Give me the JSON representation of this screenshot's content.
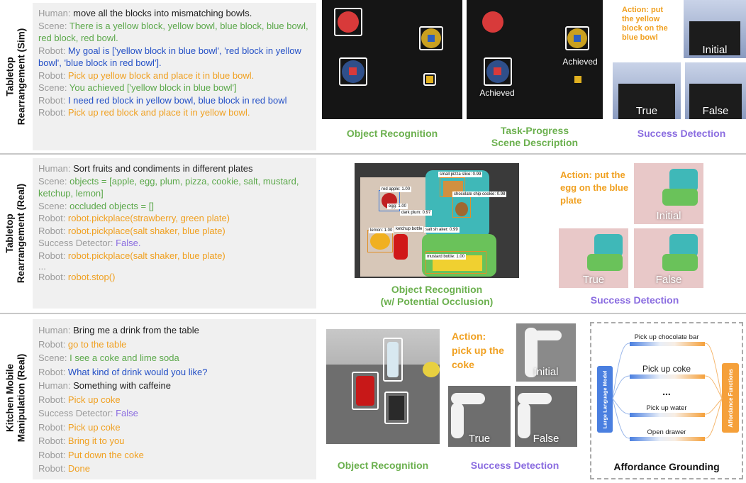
{
  "rows": [
    {
      "label": "Tabletop\nRearrangement (Sim)",
      "dialog": [
        {
          "speaker": "Human: ",
          "text": "move all the blocks into mismatching bowls.",
          "color": "human"
        },
        {
          "speaker": "Scene: ",
          "text": "There is a yellow block, yellow bowl, blue block, blue bowl, red block, red bowl.",
          "color": "scene"
        },
        {
          "speaker": "Robot: ",
          "text": "My goal is ['yellow block in blue bowl', 'red block in yellow bowl', 'blue block in red bowl'].",
          "color": "robot-blue"
        },
        {
          "speaker": "Robot: ",
          "text": "Pick up yellow block and place it in blue bowl.",
          "color": "robot-orange"
        },
        {
          "speaker": "Scene: ",
          "text": "You achieved ['yellow block in blue bowl']",
          "color": "scene"
        },
        {
          "speaker": "Robot: ",
          "text": "I need red block in yellow bowl, blue block in red bowl",
          "color": "robot-blue"
        },
        {
          "speaker": "Robot: ",
          "text": "Pick up red block and place it in yellow bowl.",
          "color": "robot-orange"
        }
      ],
      "captions": {
        "object_recognition": "Object Recognition",
        "task_progress": "Task-Progress\nScene Description",
        "success_detection": "Success Detection"
      },
      "achieved_label": "Achieved",
      "action": "Action: put the yellow block on the blue bowl",
      "initial": "Initial",
      "true": "True",
      "false": "False"
    },
    {
      "label": "Tabletop\nRearrangement (Real)",
      "dialog": [
        {
          "speaker": "Human: ",
          "text": "Sort fruits and condiments in different plates",
          "color": "human"
        },
        {
          "speaker": "Scene: ",
          "text": "objects = [apple, egg, plum, pizza, cookie, salt, mustard, ketchup, lemon]",
          "color": "scene"
        },
        {
          "speaker": "Scene: ",
          "text": "occluded objects = []",
          "color": "scene"
        },
        {
          "speaker": "Robot: ",
          "text": "robot.pickplace(strawberry, green plate)",
          "color": "robot-orange"
        },
        {
          "speaker": "Robot: ",
          "text": "robot.pickplace(salt shaker, blue plate)",
          "color": "robot-orange"
        },
        {
          "speaker": "Success Detector: ",
          "text": "False.",
          "color": "success"
        },
        {
          "speaker": "Robot: ",
          "text": "robot.pickplace(salt shaker, blue plate)",
          "color": "robot-orange"
        },
        {
          "speaker": "...",
          "text": "",
          "color": "gray"
        },
        {
          "speaker": "Robot: ",
          "text": "robot.stop()",
          "color": "robot-orange"
        }
      ],
      "detections": [
        {
          "label": "small pizza slice: 0.99"
        },
        {
          "label": "chocolate chip cookie: 0.98"
        },
        {
          "label": "red apple: 1.00"
        },
        {
          "label": "egg: 1.00"
        },
        {
          "label": "dark plum: 0.97"
        },
        {
          "label": "lemon: 1.00"
        },
        {
          "label": "ketchup bottle"
        },
        {
          "label": "salt sh aker: 0.99"
        },
        {
          "label": "mustard bottle: 1.00"
        }
      ],
      "captions": {
        "object_recognition": "Object Recognition\n(w/ Potential Occlusion)",
        "success_detection": "Success Detection"
      },
      "action": "Action: put the egg on the blue plate",
      "initial": "Initial",
      "true": "True",
      "false": "False"
    },
    {
      "label": "Kitchen Mobile\nManipulation (Real)",
      "dialog": [
        {
          "speaker": "Human: ",
          "text": "Bring me a drink from the table",
          "color": "human"
        },
        {
          "speaker": "Robot: ",
          "text": "go to the table",
          "color": "robot-orange"
        },
        {
          "speaker": "Scene: ",
          "text": "I see a coke and lime soda",
          "color": "scene"
        },
        {
          "speaker": "Robot: ",
          "text": "What kind of drink would you like?",
          "color": "robot-blue"
        },
        {
          "speaker": "Human: ",
          "text": "Something with caffeine",
          "color": "human"
        },
        {
          "speaker": "Robot: ",
          "text": "Pick up coke",
          "color": "robot-orange"
        },
        {
          "speaker": "Success Detector: ",
          "text": "False",
          "color": "success"
        },
        {
          "speaker": "Robot: ",
          "text": "Pick up coke",
          "color": "robot-orange"
        },
        {
          "speaker": "Robot: ",
          "text": "Bring it to you",
          "color": "robot-orange"
        },
        {
          "speaker": "Robot: ",
          "text": "Put down the coke",
          "color": "robot-orange"
        },
        {
          "speaker": "Robot: ",
          "text": "Done",
          "color": "robot-orange"
        }
      ],
      "captions": {
        "object_recognition": "Object Recognition",
        "success_detection": "Success Detection",
        "affordance_grounding": "Affordance Grounding"
      },
      "action": "Action: pick up the coke",
      "initial": "Initial",
      "true": "True",
      "false": "False",
      "affordance": {
        "llm": "Large Language Model",
        "functions": "Affordance Functions",
        "items": [
          "Pick up chocolate bar",
          "Pick up coke",
          "...",
          "Pick up water",
          "Open drawer"
        ]
      }
    }
  ],
  "colors": {
    "human": "#222222",
    "scene": "#5ba84a",
    "robot_blue": "#2450c6",
    "robot_orange": "#f0a020",
    "success": "#8a6ce0",
    "caption_green": "#6bb04e",
    "caption_purple": "#8a6ce0",
    "llm_blue": "#4a7fe0",
    "affordance_orange": "#f5a03a"
  }
}
